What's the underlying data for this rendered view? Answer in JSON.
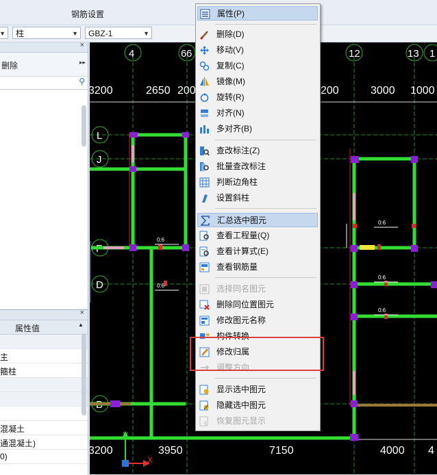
{
  "window": {
    "title": "钢筋设置"
  },
  "toolbar": {
    "combo1": "柱",
    "combo2": "GBZ-1"
  },
  "left_panel": {
    "close": "×",
    "delete_label": "删除",
    "more": "▸▸",
    "scroll_up": "▲",
    "prop_header": "属性值",
    "rows": [
      "主",
      "箍柱",
      "",
      "",
      "",
      "混凝土",
      "通混凝土)",
      "0)"
    ]
  },
  "canvas": {
    "axis_top": [
      "4",
      "6",
      "6",
      "12",
      "13",
      "1"
    ],
    "dims_top": [
      "3200",
      "2650",
      "200",
      "200",
      "3000",
      "1000"
    ],
    "dims_bottom": [
      "3200",
      "3950",
      "7150",
      "4000",
      "4"
    ],
    "axis_left": [
      "L",
      "J",
      "F",
      "D",
      "B"
    ],
    "rebar_label": "0:6",
    "axis_x": "X",
    "axis_y": "Y"
  },
  "context_menu": {
    "items": [
      {
        "label": "属性(P)",
        "icon": "properties-icon",
        "state": "highlight"
      },
      {
        "label": "删除(D)",
        "icon": "delete-brush-icon",
        "state": "normal"
      },
      {
        "label": "移动(V)",
        "icon": "move-icon",
        "state": "normal"
      },
      {
        "label": "复制(C)",
        "icon": "copy-icon",
        "state": "normal"
      },
      {
        "label": "镜像(M)",
        "icon": "mirror-icon",
        "state": "normal"
      },
      {
        "label": "旋转(R)",
        "icon": "rotate-icon",
        "state": "normal"
      },
      {
        "label": "对齐(N)",
        "icon": "align-icon",
        "state": "normal"
      },
      {
        "label": "多对齐(B)",
        "icon": "multi-align-icon",
        "state": "normal"
      },
      {
        "label": "查改标注(Z)",
        "icon": "edit-annotation-icon",
        "state": "normal"
      },
      {
        "label": "批量查改标注",
        "icon": "batch-annotation-icon",
        "state": "normal"
      },
      {
        "label": "判断边角柱",
        "icon": "corner-column-icon",
        "state": "normal"
      },
      {
        "label": "设置斜柱",
        "icon": "slant-column-icon",
        "state": "normal"
      },
      {
        "label": "汇总选中图元",
        "icon": "sum-icon",
        "state": "highlight"
      },
      {
        "label": "查看工程量(Q)",
        "icon": "quantity-icon",
        "state": "normal"
      },
      {
        "label": "查看计算式(E)",
        "icon": "formula-icon",
        "state": "normal"
      },
      {
        "label": "查看钢筋量",
        "icon": "rebar-icon",
        "state": "normal"
      },
      {
        "label": "选择同名图元",
        "icon": "select-same-icon",
        "state": "disabled"
      },
      {
        "label": "删除同位置图元",
        "icon": "delete-same-pos-icon",
        "state": "normal"
      },
      {
        "label": "修改图元名称",
        "icon": "rename-icon",
        "state": "normal"
      },
      {
        "label": "构件转换",
        "icon": "convert-icon",
        "state": "normal"
      },
      {
        "label": "修改归属",
        "icon": "change-owner-icon",
        "state": "normal"
      },
      {
        "label": "调整方向",
        "icon": "adjust-direction-icon",
        "state": "disabled"
      },
      {
        "label": "显示选中图元",
        "icon": "show-selected-icon",
        "state": "normal"
      },
      {
        "label": "隐藏选中图元",
        "icon": "hide-selected-icon",
        "state": "normal"
      },
      {
        "label": "恢复图元显示",
        "icon": "restore-display-icon",
        "state": "disabled"
      }
    ]
  },
  "colors": {
    "wall": "#33dd33",
    "column": "#8a1fd8",
    "axis": "#2fae2f",
    "highlight_box": "#d9423c"
  }
}
